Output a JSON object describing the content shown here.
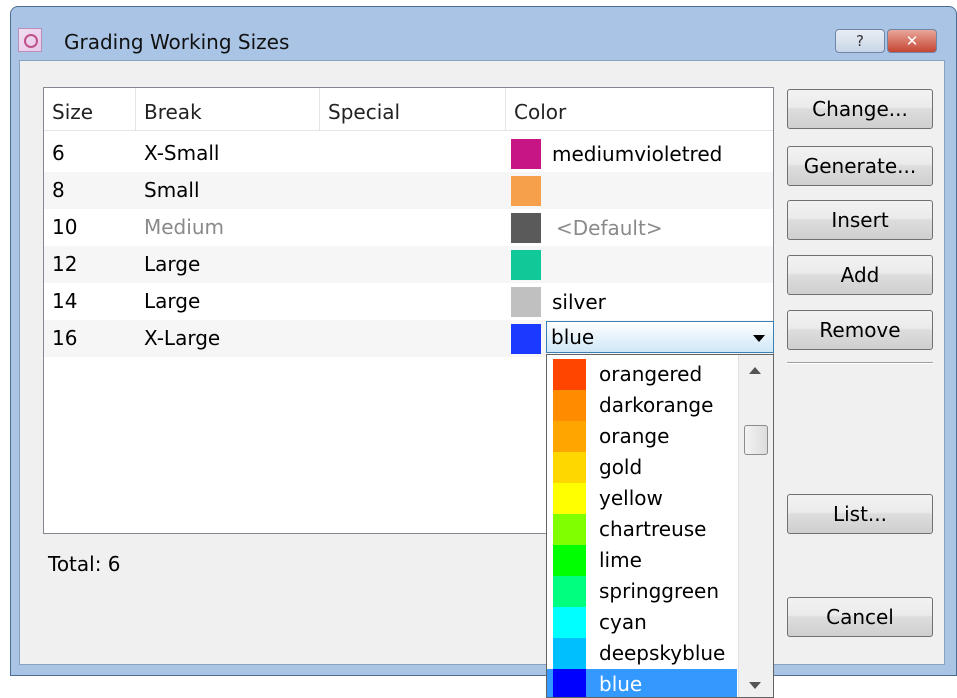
{
  "window": {
    "title": "Grading Working Sizes",
    "help_label": "?",
    "close_label": "✕"
  },
  "table": {
    "headers": [
      "Size",
      "Break",
      "Special",
      "Color"
    ],
    "rows": [
      {
        "size": "6",
        "break": "X-Small",
        "special": "",
        "color_hex": "#c71585",
        "color_label": "mediumvioletred"
      },
      {
        "size": "8",
        "break": "Small",
        "special": "",
        "color_hex": "#f7a04b",
        "color_label": ""
      },
      {
        "size": "10",
        "break": "Medium",
        "special": "",
        "color_hex": "#5a5a5a",
        "color_label": "<Default>"
      },
      {
        "size": "12",
        "break": "Large",
        "special": "",
        "color_hex": "#10c898",
        "color_label": ""
      },
      {
        "size": "14",
        "break": "Large",
        "special": "",
        "color_hex": "#c0c0c0",
        "color_label": "silver"
      },
      {
        "size": "16",
        "break": "X-Large",
        "special": "",
        "color_hex": "#1a3bff",
        "color_label": "blue"
      }
    ]
  },
  "color_combo": {
    "value": "blue"
  },
  "color_options": [
    {
      "label": "orangered",
      "hex": "#ff4500"
    },
    {
      "label": "darkorange",
      "hex": "#ff8c00"
    },
    {
      "label": "orange",
      "hex": "#ffa500"
    },
    {
      "label": "gold",
      "hex": "#ffd700"
    },
    {
      "label": "yellow",
      "hex": "#ffff00"
    },
    {
      "label": "chartreuse",
      "hex": "#7fff00"
    },
    {
      "label": "lime",
      "hex": "#00ff00"
    },
    {
      "label": "springgreen",
      "hex": "#00ff7f"
    },
    {
      "label": "cyan",
      "hex": "#00ffff"
    },
    {
      "label": "deepskyblue",
      "hex": "#00bfff"
    },
    {
      "label": "blue",
      "hex": "#0000ff"
    }
  ],
  "buttons": {
    "change": "Change...",
    "generate": "Generate...",
    "insert": "Insert",
    "add": "Add",
    "remove": "Remove",
    "list": "List...",
    "cancel": "Cancel"
  },
  "footer": {
    "total": "Total: 6"
  }
}
